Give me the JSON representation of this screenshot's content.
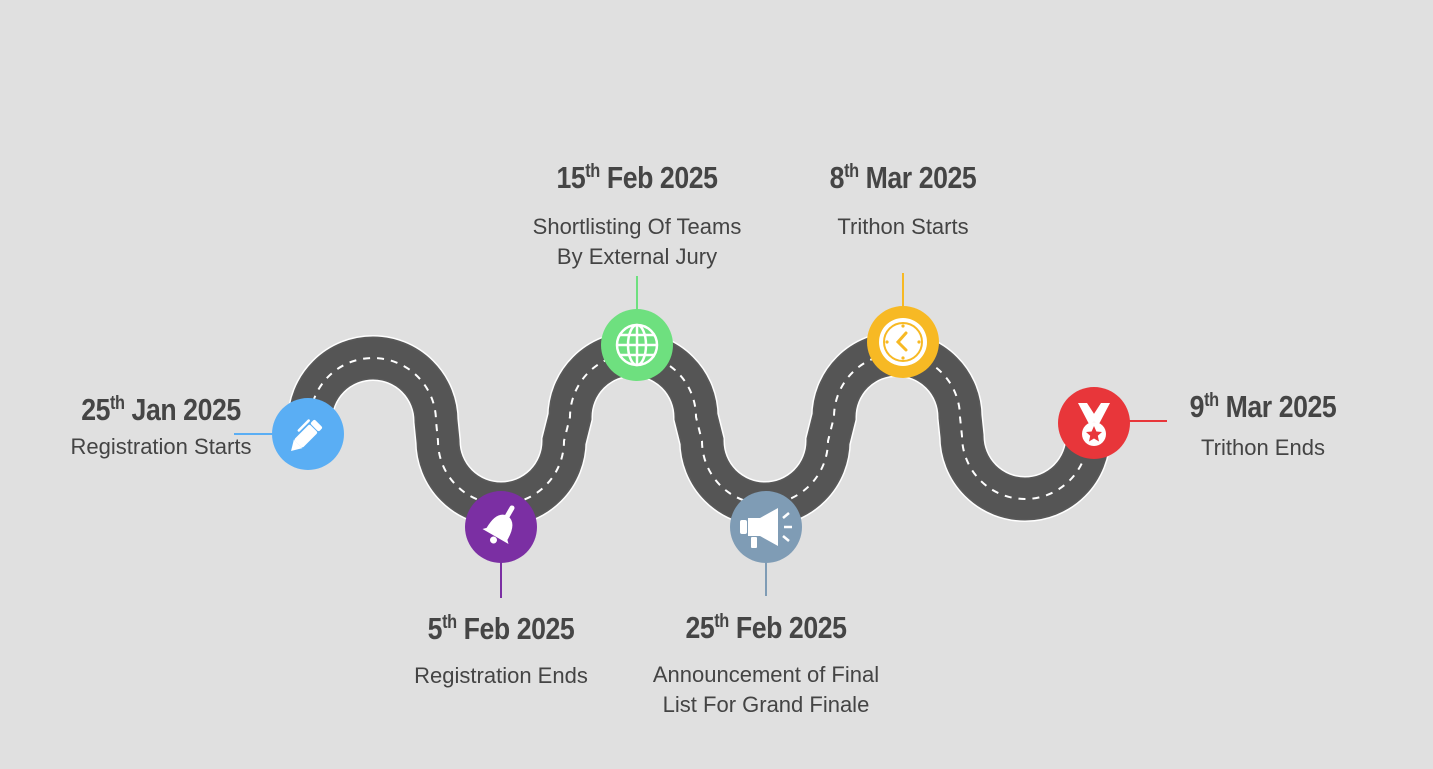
{
  "milestones": [
    {
      "day": "25",
      "suffix": "th",
      "monthyear": "Jan 2025",
      "description": [
        "Registration Starts"
      ],
      "color": "#5aaef4",
      "icon": "pen-icon"
    },
    {
      "day": "5",
      "suffix": "th",
      "monthyear": "Feb 2025",
      "description": [
        "Registration Ends"
      ],
      "color": "#7b2fa3",
      "icon": "bell-icon"
    },
    {
      "day": "15",
      "suffix": "th",
      "monthyear": "Feb 2025",
      "description": [
        "Shortlisting Of Teams",
        "By External Jury"
      ],
      "color": "#6ee07f",
      "icon": "globe-icon"
    },
    {
      "day": "25",
      "suffix": "th",
      "monthyear": "Feb 2025",
      "description": [
        "Announcement of Final",
        "List For Grand Finale"
      ],
      "color": "#7f9cb5",
      "icon": "megaphone-icon"
    },
    {
      "day": "8",
      "suffix": "th",
      "monthyear": "Mar 2025",
      "description": [
        "Trithon Starts"
      ],
      "color": "#f7b924",
      "icon": "clock-icon"
    },
    {
      "day": "9",
      "suffix": "th",
      "monthyear": "Mar 2025",
      "description": [
        "Trithon Ends"
      ],
      "color": "#e8363a",
      "icon": "medal-icon"
    }
  ]
}
